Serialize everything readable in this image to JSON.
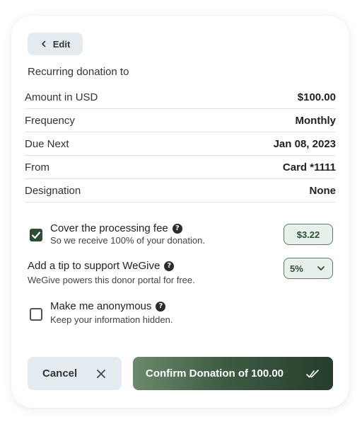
{
  "edit_button": {
    "label": "Edit",
    "icon": "chevron-left-icon"
  },
  "recurring_title": "Recurring donation to",
  "summary": [
    {
      "label": "Amount in USD",
      "value": "$100.00"
    },
    {
      "label": "Frequency",
      "value": "Monthly"
    },
    {
      "label": "Due Next",
      "value": "Jan 08, 2023"
    },
    {
      "label": "From",
      "value": "Card *1111"
    },
    {
      "label": "Designation",
      "value": "None"
    }
  ],
  "processing_fee": {
    "label": "Cover the processing fee",
    "sub": "So we receive 100% of your donation.",
    "checked": true,
    "amount": "$3.22"
  },
  "tip": {
    "label": "Add a tip to support WeGive",
    "sub": "WeGive powers this donor portal for free.",
    "selected": "5%"
  },
  "anonymous": {
    "label": "Make me anonymous",
    "sub": "Keep your information hidden.",
    "checked": false
  },
  "help_glyph": "?",
  "cancel_button": {
    "label": "Cancel",
    "icon": "close-icon"
  },
  "confirm_button": {
    "label": "Confirm Donation of 100.00",
    "icon": "double-check-icon"
  },
  "colors": {
    "accent_dark": "#2e4d35",
    "accent_light": "#e7f0ea",
    "secondary_button": "#e4ecf2"
  }
}
